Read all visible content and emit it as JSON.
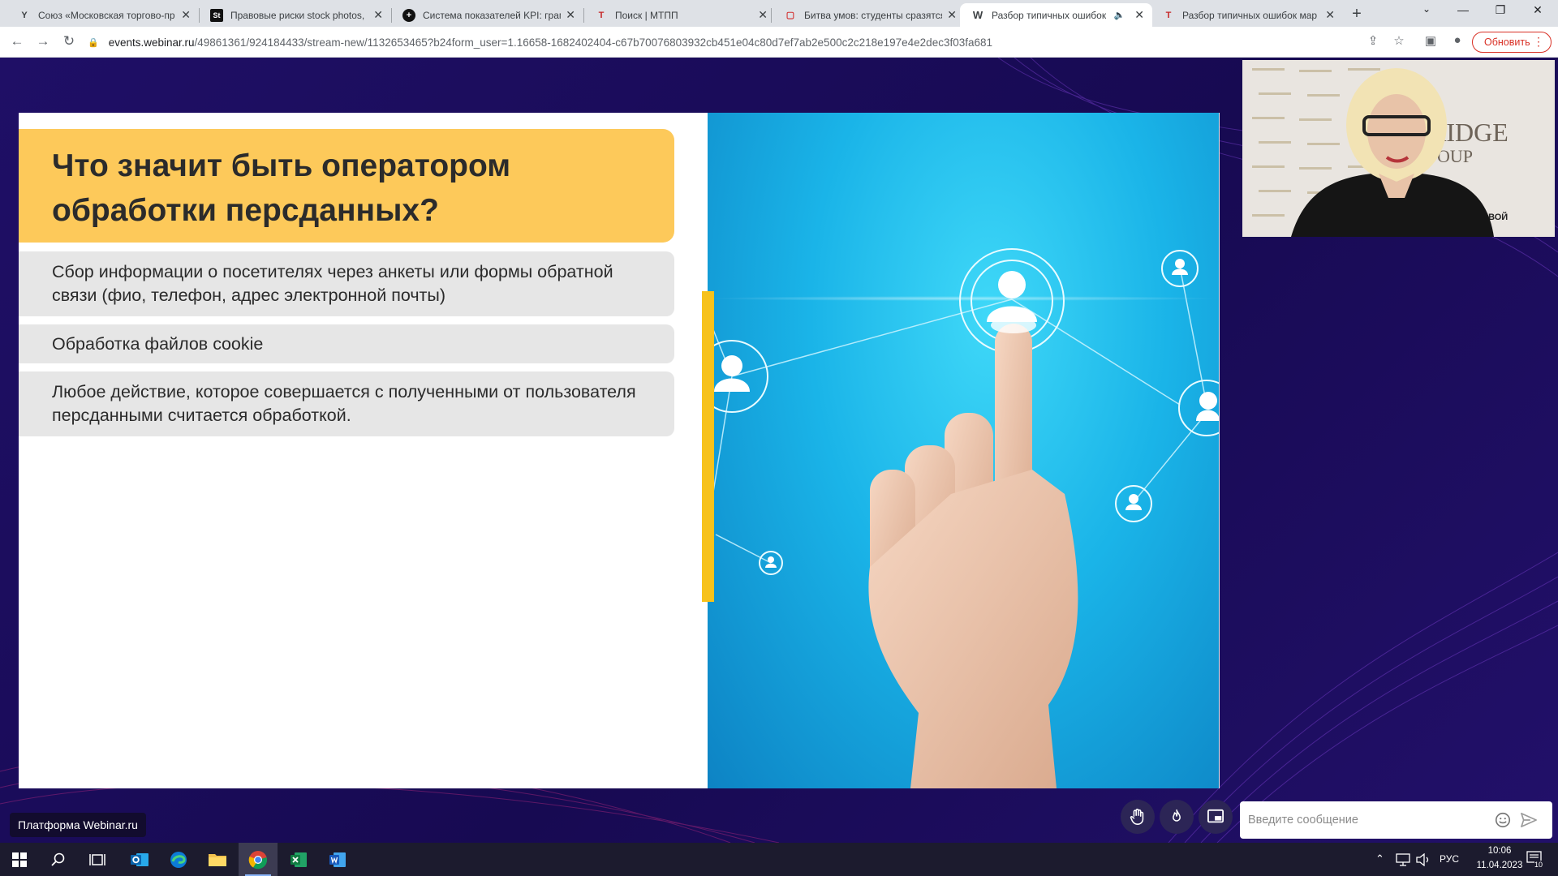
{
  "browser": {
    "tabs": [
      {
        "title": "Союз «Московская торгово-пр",
        "favicon": "Y",
        "favicon_color": "#000000",
        "active": false
      },
      {
        "title": "Правовые риски stock photos,",
        "favicon": "St",
        "favicon_color": "#000000",
        "active": false
      },
      {
        "title": "Система показателей KPI: грам",
        "favicon": "+",
        "favicon_color": "#000000",
        "active": false
      },
      {
        "title": "Поиск | МТПП",
        "favicon": "T",
        "favicon_color": "#c62828",
        "active": false
      },
      {
        "title": "Битва умов: студенты сразятся",
        "favicon": "▢",
        "favicon_color": "#d32f2f",
        "active": false
      },
      {
        "title": "Разбор типичных ошибок",
        "favicon": "W",
        "favicon_color": "#000000",
        "active": true
      },
      {
        "title": "Разбор типичных ошибок мар",
        "favicon": "T",
        "favicon_color": "#c62828",
        "active": false
      }
    ],
    "url_host": "events.webinar.ru",
    "url_path": "/49861361/924184433/stream-new/1132653465?b24form_user=1.16658-1682402404-c67b70076803932cb451e04c80d7ef7ab2e500c2c218e197e4e2dec3f03fa681",
    "update_label": "Обновить"
  },
  "slide": {
    "title": "Что значит быть оператором обработки персданных?",
    "bullets": [
      "Сбор информации о посетителях через анкеты или формы обратной связи (фио, телефон, адрес электронной почты)",
      "Обработка файлов cookie",
      "Любое действие, которое совершается с полученными от пользователя персданными считается обработкой."
    ]
  },
  "camera": {
    "backdrop_logo_line1": "RIDGE",
    "backdrop_logo_line2": "OUP",
    "backdrop_caption": "ЧЕВОЙ"
  },
  "platform_label": "Платформа Webinar.ru",
  "chat": {
    "placeholder": "Введите сообщение"
  },
  "taskbar": {
    "language": "РУС",
    "time": "10:06",
    "date": "11.04.2023",
    "notifications": "10"
  },
  "colors": {
    "stage_bg": "#1a0b5c",
    "title_accent": "#fdc95a",
    "bar_accent": "#f7c21b",
    "update_red": "#d93025"
  }
}
